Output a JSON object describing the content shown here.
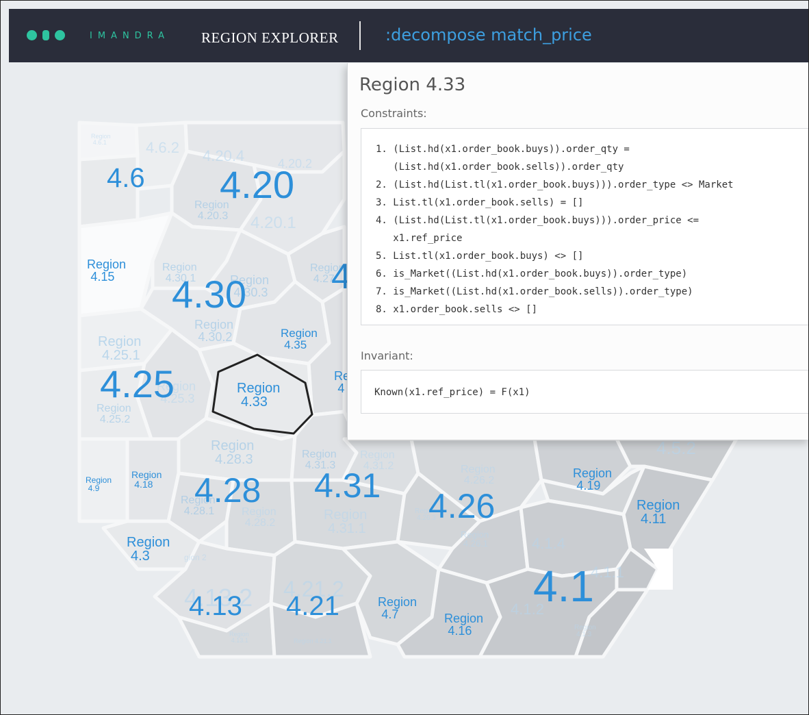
{
  "app": {
    "brand": "IMANDRA",
    "title": "REGION EXPLORER",
    "command": ":decompose match_price",
    "accent": "#2ec4a0",
    "command_color": "#3d9fe0"
  },
  "detail_panel": {
    "title": "Region 4.33",
    "constraints_label": "Constraints:",
    "constraints": [
      "1. (List.hd(x1.order_book.buys)).order_qty =",
      "   (List.hd(x1.order_book.sells)).order_qty",
      "2. (List.hd(List.tl(x1.order_book.buys))).order_type <> Market",
      "3. List.tl(x1.order_book.sells) = []",
      "4. (List.hd(List.tl(x1.order_book.buys))).order_price <=",
      "   x1.ref_price",
      "5. List.tl(x1.order_book.buys) <> []",
      "6. is_Market((List.hd(x1.order_book.buys)).order_type)",
      "7. is_Market((List.hd(x1.order_book.sells)).order_type)",
      "8. x1.order_book.sells <> []"
    ],
    "invariant_label": "Invariant:",
    "invariant": "Known(x1.ref_price) = F(x1)"
  },
  "regions": {
    "r4_6": "4.6",
    "r4_20": "4.20",
    "r4_20_4": "4.20.4",
    "r4_20_2": "4.20.2",
    "r4_20_3": "Region\n4.20.3",
    "r4_20_1": "4.20.1",
    "r4_6_1": "Region\n4.6.1",
    "r4_6_2": "4.6.2",
    "r4_15": "Region\n4.15",
    "r4_30": "4.30",
    "r4_30_1": "Region\n4.30.1",
    "r4_30_3": "Region\n4.30.3",
    "r4_30_2": "Region\n4.30.2",
    "r4_27": "Region\n4.27",
    "r4_27_big": "4",
    "r4_35": "Region\n4.35",
    "r4_25": "4.25",
    "r4_25_1": "Region\n4.25.1",
    "r4_25_2": "Region\n4.25.2",
    "r4_25_3": "Region\n4.25.3",
    "r4_33": "Region\n4.33",
    "r4_34_partial": "Re\n4",
    "r4_28": "4.28",
    "r4_28_3": "Region\n4.28.3",
    "r4_28_1": "Region\n4.28.1",
    "r4_28_2": "Region\n4.28.2",
    "r4_31": "4.31",
    "r4_31_3": "Region\n4.31.3",
    "r4_31_2": "Region\n4.31.2",
    "r4_31_1": "Region\n4.31.1",
    "r4_26": "4.26",
    "r4_26_2": "Region\n4.26.2",
    "r4_26_3": "Region\n4.26.3",
    "r4_26_1": "Region\n4.26.1",
    "r4_9": "Region\n4.9",
    "r4_18": "Region\n4.18",
    "r4_3": "Region\n4.3",
    "r4_13": "4.13",
    "r4_13_2": "4.13.2",
    "r4_13_1": "Region\n4.13.1",
    "r4_21": "4.21",
    "r4_21_2": "4.21.2",
    "r4_21_1": "Region 4.21.1",
    "r4_7": "Region\n4.7",
    "r4_16": "Region\n4.16",
    "r4_19": "Region\n4.19",
    "r4_11": "Region\n4.11",
    "r4_1": "4.1",
    "r4_1_4": "4.1.4",
    "r4_1_1": "4.1.1",
    "r4_1_2": "4.1.2",
    "r4_1_3": "Region\n4.1.3",
    "r4_5_2": "4.5.2",
    "r4_2_partial": "gion 2"
  }
}
